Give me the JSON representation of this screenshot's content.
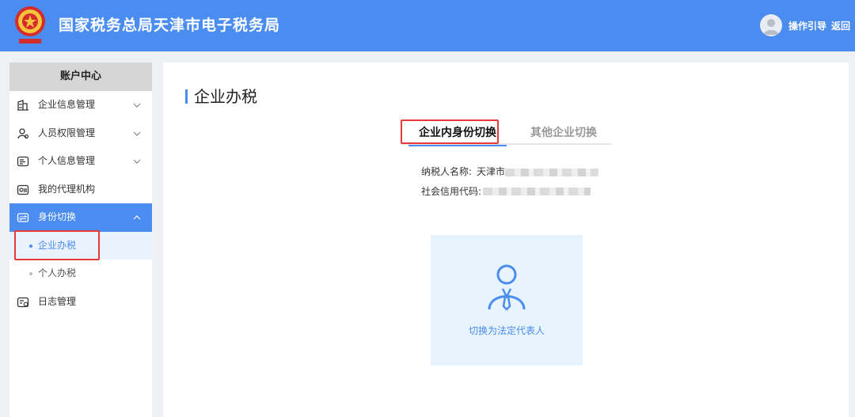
{
  "header": {
    "title": "国家税务总局天津市电子税务局",
    "guide_label": "操作引导",
    "back_label": "返回"
  },
  "sidebar": {
    "heading": "账户中心",
    "items": [
      {
        "label": "企业信息管理",
        "icon": "building-icon",
        "expandable": true
      },
      {
        "label": "人员权限管理",
        "icon": "user-permission-icon",
        "expandable": true
      },
      {
        "label": "个人信息管理",
        "icon": "id-card-icon",
        "expandable": true
      },
      {
        "label": "我的代理机构",
        "icon": "agency-icon",
        "expandable": false
      },
      {
        "label": "身份切换",
        "icon": "switch-identity-icon",
        "expandable": true,
        "expanded": true,
        "active": true
      },
      {
        "label": "日志管理",
        "icon": "log-calendar-icon",
        "expandable": false
      }
    ],
    "sub_items": [
      {
        "label": "企业办税",
        "selected": true
      },
      {
        "label": "个人办税",
        "selected": false
      }
    ]
  },
  "main": {
    "title": "企业办税",
    "tabs": [
      {
        "label": "企业内身份切换",
        "active": true
      },
      {
        "label": "其他企业切换",
        "active": false
      }
    ],
    "taxpayer_name_label": "纳税人名称:",
    "taxpayer_name_value": "天津市",
    "credit_code_label": "社会信用代码:",
    "card_label": "切换为法定代表人"
  },
  "colors": {
    "primary": "#4a8cf0",
    "highlight_box": "#e53a3a",
    "card_bg": "#e7f4fd"
  }
}
